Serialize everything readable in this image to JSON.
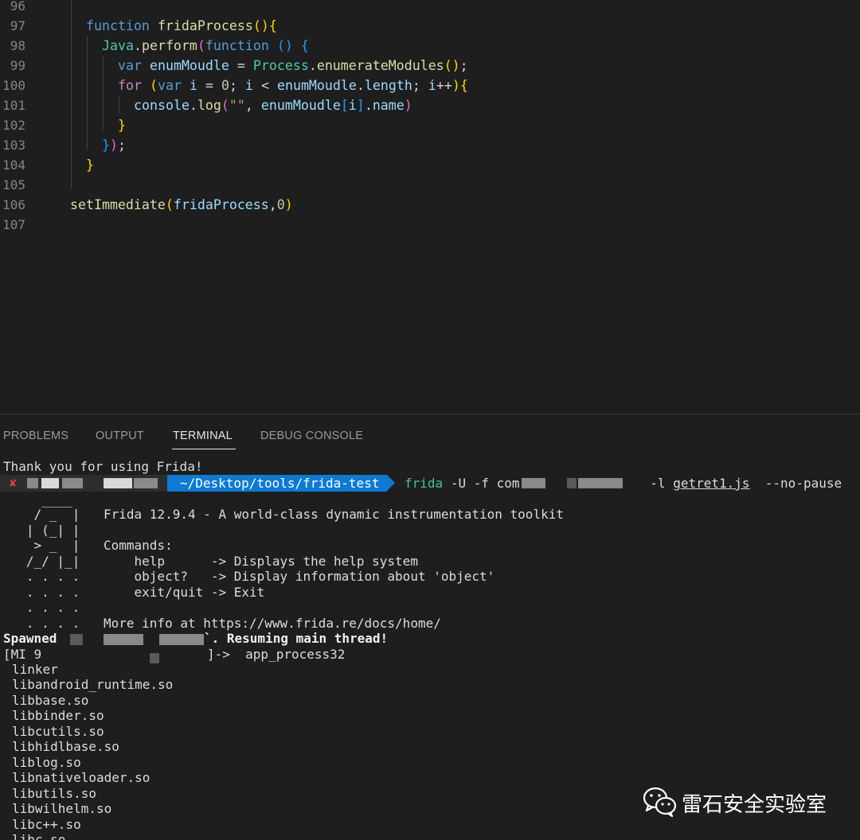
{
  "editor": {
    "line_numbers": [
      "96",
      "97",
      "98",
      "99",
      "100",
      "101",
      "102",
      "103",
      "104",
      "105",
      "106",
      "107"
    ]
  },
  "panel": {
    "tabs": [
      {
        "label": "PROBLEMS"
      },
      {
        "label": "OUTPUT"
      },
      {
        "label": "TERMINAL",
        "active": true
      },
      {
        "label": "DEBUG CONSOLE"
      }
    ]
  },
  "terminal": {
    "thanks": "Thank you for using Frida!",
    "prompt": {
      "status_icon": "✘",
      "path": "~/Desktop/tools/frida-test",
      "cmd_name": "frida",
      "cmd_args1": "-U -f com",
      "cmd_args2": "-l",
      "cmd_script": "getret1.js",
      "cmd_args3": "--no-pause"
    },
    "banner": {
      "art_1": "     ____",
      "art_2": "    / _  |",
      "art_3": "   | (_| |",
      "art_4": "    > _  |",
      "art_5": "   /_/ |_|",
      "art_6": "   . . . .",
      "art_7": "   . . . .",
      "art_8": "   . . . .",
      "art_9": "   . . . .",
      "version_line": "Frida 12.9.4 - A world-class dynamic instrumentation toolkit",
      "commands_label": "Commands:",
      "cmd_help": "    help      -> Displays the help system",
      "cmd_object": "    object?   -> Display information about 'object'",
      "cmd_exit": "    exit/quit -> Exit",
      "more_info": "More info at https://www.frida.re/docs/home/"
    },
    "spawned_prefix": "Spawned",
    "spawned_suffix": "`. Resuming main thread!",
    "repl_prefix": "[MI 9",
    "repl_suffix": "]->  app_process32",
    "modules": [
      "linker",
      "libandroid_runtime.so",
      "libbase.so",
      "libbinder.so",
      "libcutils.so",
      "libhidlbase.so",
      "liblog.so",
      "libnativeloader.so",
      "libutils.so",
      "libwilhelm.so",
      "libc++.so",
      "libc.so"
    ]
  },
  "watermark": {
    "text": "雷石安全实验室",
    "icon": "wechat-icon"
  },
  "colors": {
    "background": "#1e1e1e",
    "prompt_path_bg": "#0e7ad4",
    "frida_cmd": "#3ec78a",
    "error_x": "#e04444"
  }
}
